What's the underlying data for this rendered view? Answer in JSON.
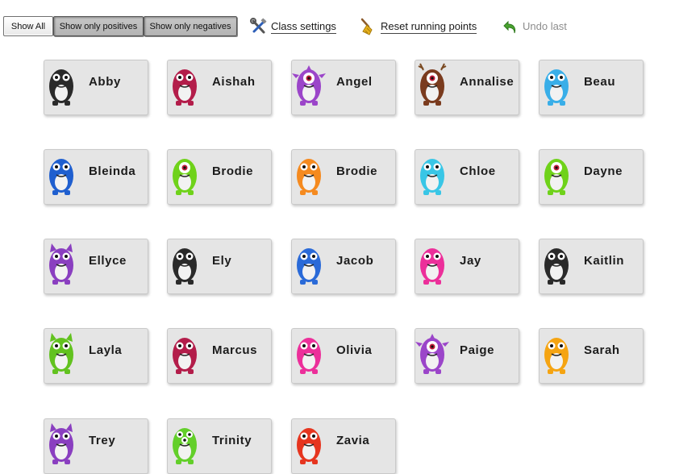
{
  "toolbar": {
    "show_all": "Show All",
    "show_positives": "Show only positives",
    "show_negatives": "Show only negatives",
    "class_settings": "Class settings",
    "class_settings_icon": "tools-icon",
    "reset_points": "Reset running points",
    "reset_points_icon": "broom-icon",
    "undo_last": "Undo last",
    "undo_icon": "undo-arrow-icon"
  },
  "students": [
    {
      "name": "Abby",
      "avatar": "black-white-monster",
      "color": "#2a2a2a"
    },
    {
      "name": "Aishah",
      "avatar": "crimson-monster",
      "color": "#b31d4a"
    },
    {
      "name": "Angel",
      "avatar": "purple-spiky-monster",
      "color": "#9b45c9"
    },
    {
      "name": "Annalise",
      "avatar": "brown-antler-monster",
      "color": "#7a3b1e"
    },
    {
      "name": "Beau",
      "avatar": "blue-furry-monster",
      "color": "#39aee8"
    },
    {
      "name": "Bleinda",
      "avatar": "blue-monster",
      "color": "#1f5fcf"
    },
    {
      "name": "Brodie",
      "avatar": "green-cyclops-monster",
      "color": "#6fd21a"
    },
    {
      "name": "Brodie",
      "avatar": "orange-monster",
      "color": "#f58a1f"
    },
    {
      "name": "Chloe",
      "avatar": "cyan-monster",
      "color": "#39c6e6"
    },
    {
      "name": "Dayne",
      "avatar": "green-cyclops-monster",
      "color": "#6fd21a"
    },
    {
      "name": "Ellyce",
      "avatar": "purple-cat-monster",
      "color": "#8a3fc0"
    },
    {
      "name": "Ely",
      "avatar": "black-white-monster",
      "color": "#2a2a2a"
    },
    {
      "name": "Jacob",
      "avatar": "blue-bird-monster",
      "color": "#2a6ad8"
    },
    {
      "name": "Jay",
      "avatar": "pink-monster",
      "color": "#ec2f9a"
    },
    {
      "name": "Kaitlin",
      "avatar": "black-white-monster",
      "color": "#2a2a2a"
    },
    {
      "name": "Layla",
      "avatar": "green-horned-monster",
      "color": "#62c21f"
    },
    {
      "name": "Marcus",
      "avatar": "crimson-monster",
      "color": "#b31d4a"
    },
    {
      "name": "Olivia",
      "avatar": "pink-monster",
      "color": "#ec2f9a"
    },
    {
      "name": "Paige",
      "avatar": "purple-spiky-monster",
      "color": "#9b45c9"
    },
    {
      "name": "Sarah",
      "avatar": "yellow-orange-monster",
      "color": "#f5a412"
    },
    {
      "name": "Trey",
      "avatar": "purple-cat-monster",
      "color": "#8a3fc0"
    },
    {
      "name": "Trinity",
      "avatar": "green-three-eyed-monster",
      "color": "#63cf2a"
    },
    {
      "name": "Zavia",
      "avatar": "red-monster",
      "color": "#e6351f"
    }
  ]
}
